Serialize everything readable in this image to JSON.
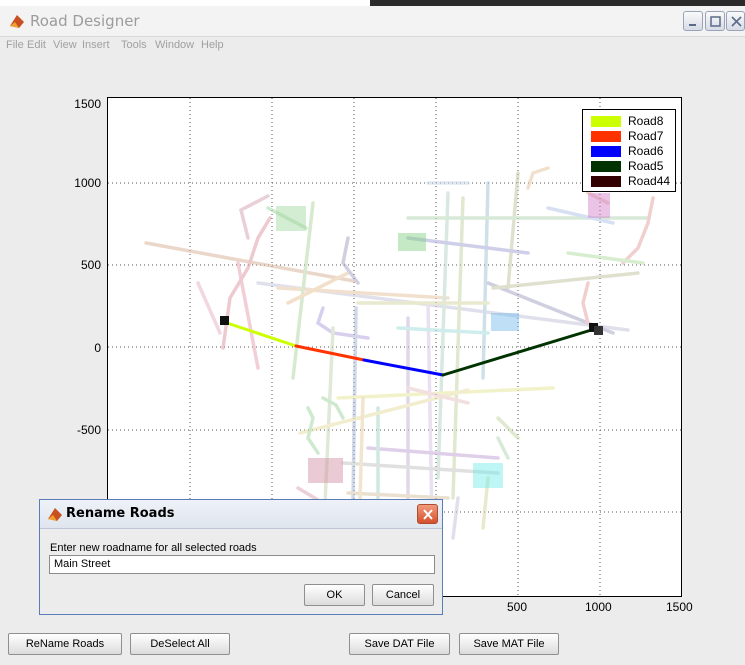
{
  "window": {
    "title": "Road Designer",
    "menu": [
      "File",
      "Edit",
      "View",
      "Insert",
      "Tools",
      "Window",
      "Help"
    ]
  },
  "plot": {
    "yticks": [
      "1500",
      "1000",
      "500",
      "0",
      "-500"
    ],
    "xticks": [
      "500",
      "1000",
      "1500"
    ]
  },
  "legend": [
    {
      "label": "Road8",
      "color": "#ccff00"
    },
    {
      "label": "Road7",
      "color": "#ff3300"
    },
    {
      "label": "Road6",
      "color": "#0000ff"
    },
    {
      "label": "Road5",
      "color": "#003300"
    },
    {
      "label": "Road44",
      "color": "#330000"
    }
  ],
  "dialog": {
    "title": "Rename Roads",
    "prompt": "Enter new roadname for all selected roads",
    "value": "Main Street",
    "ok": "OK",
    "cancel": "Cancel"
  },
  "buttons": {
    "rename": "ReName Roads",
    "deselect": "DeSelect All",
    "save_dat": "Save DAT File",
    "save_mat": "Save MAT File"
  }
}
